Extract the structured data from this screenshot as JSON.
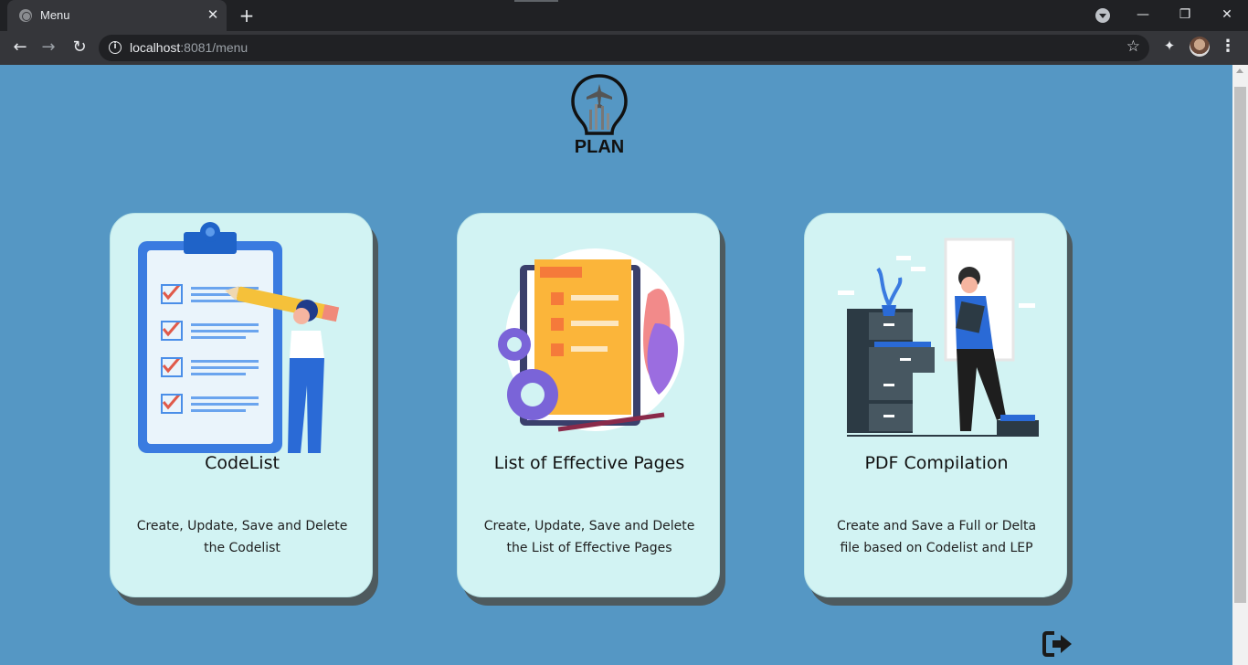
{
  "browser": {
    "tab_title": "Menu",
    "tab_close": "✕",
    "new_tab": "+",
    "url_host": "localhost",
    "url_rest": ":8081/menu",
    "back": "←",
    "forward": "→",
    "reload": "↻",
    "star": "☆",
    "extensions": "✦",
    "menu": "⋮",
    "minimize": "—",
    "restore": "❐",
    "close": "✕",
    "info": "i"
  },
  "logo": {
    "text": "PLAN",
    "icon": "lightbulb-airplane-icon"
  },
  "cards": [
    {
      "title": "CodeList",
      "description": "Create, Update, Save and Delete the Codelist",
      "illustration": "clipboard-checklist-illustration"
    },
    {
      "title": "List of Effective Pages",
      "description": "Create, Update, Save and Delete the List of Effective Pages",
      "illustration": "document-gears-illustration"
    },
    {
      "title": "PDF Compilation",
      "description": "Create and Save a Full or Delta file based on Codelist and LEP",
      "illustration": "filing-cabinet-illustration"
    }
  ],
  "logout": {
    "icon": "logout-icon"
  },
  "colors": {
    "page_bg": "#5597c4",
    "card_bg": "#d2f3f3",
    "card_shadow": "#4e5a5e"
  }
}
